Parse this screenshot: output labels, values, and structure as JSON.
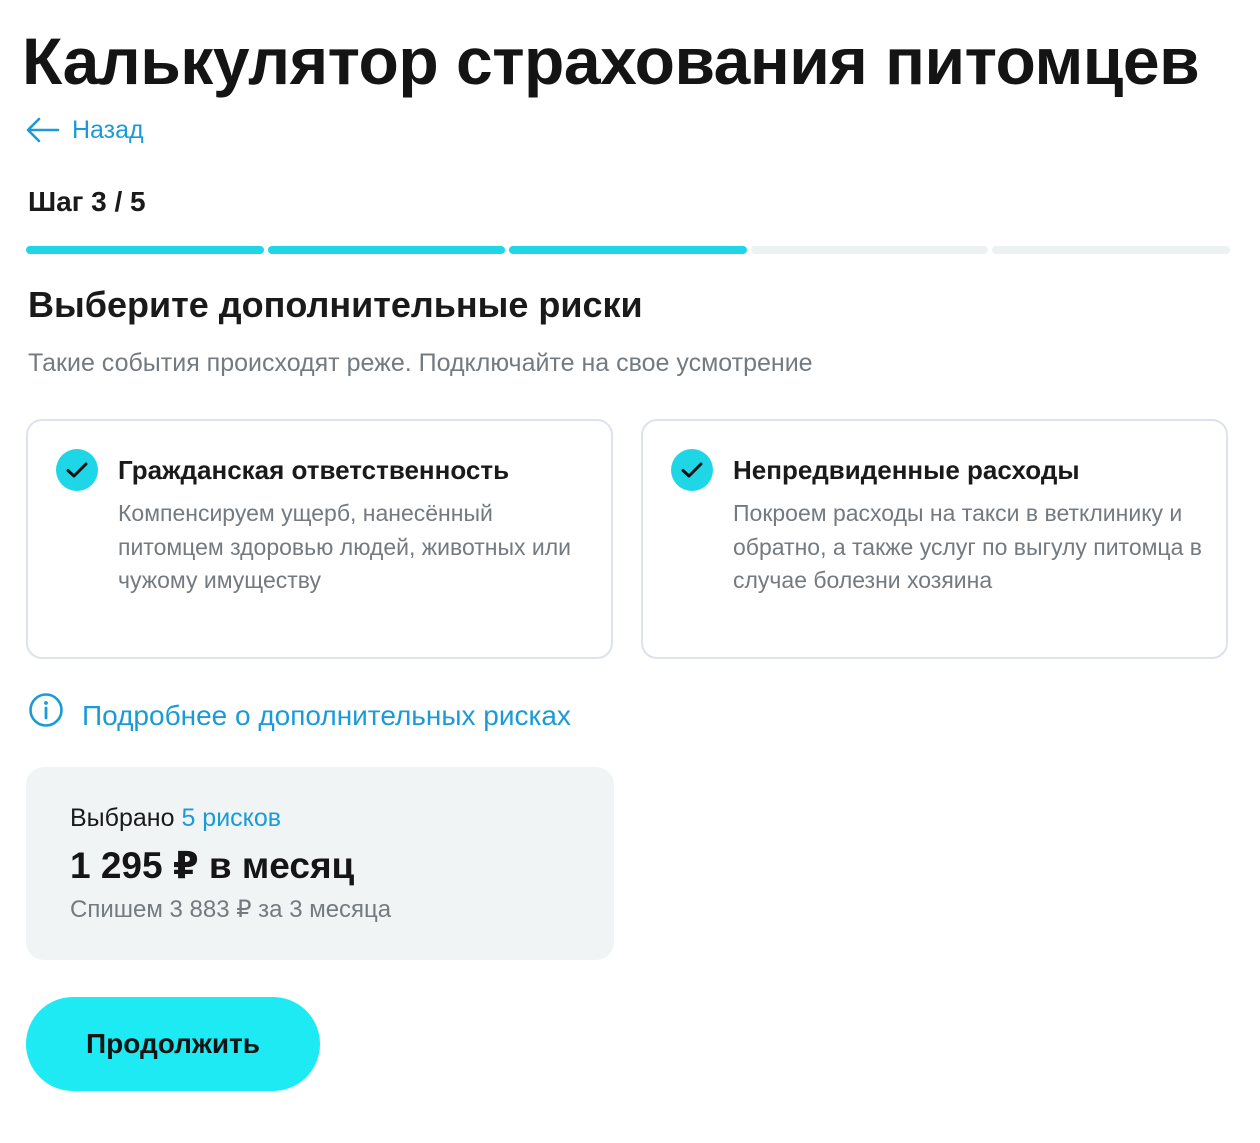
{
  "page": {
    "title": "Калькулятор страхования питомцев"
  },
  "navigation": {
    "back_label": "Назад"
  },
  "stepper": {
    "label": "Шаг 3 / 5",
    "current_step": 3,
    "total_steps": 5
  },
  "section": {
    "title": "Выберите дополнительные риски",
    "subtitle": "Такие события происходят реже. Подключайте на свое усмотрение"
  },
  "risks": [
    {
      "title": "Гражданская ответственность",
      "description": "Компенсируем ущерб, нанесённый питомцем здоровью людей, животных или чужому имуществу",
      "selected": true
    },
    {
      "title": "Непредвиденные расходы",
      "description": "Покроем расходы на такси в ветклинику и обратно, а также услуг по выгулу питомца в случае болезни хозяина",
      "selected": true
    }
  ],
  "info_link": {
    "label": "Подробнее о дополнительных рисках"
  },
  "summary": {
    "selected_prefix": "Выбрано",
    "selected_count_label": "5 рисков",
    "price": "1 295 ₽ в месяц",
    "charge_note": "Спишем 3 883 ₽ за 3 месяца"
  },
  "actions": {
    "continue_label": "Продолжить"
  },
  "colors": {
    "accent": "#1ed6e6",
    "button": "#1eeaf4",
    "link": "#1a9bd7",
    "muted_text": "#737a80",
    "card_border": "#dde2ee",
    "summary_bg": "#f0f4f5"
  }
}
